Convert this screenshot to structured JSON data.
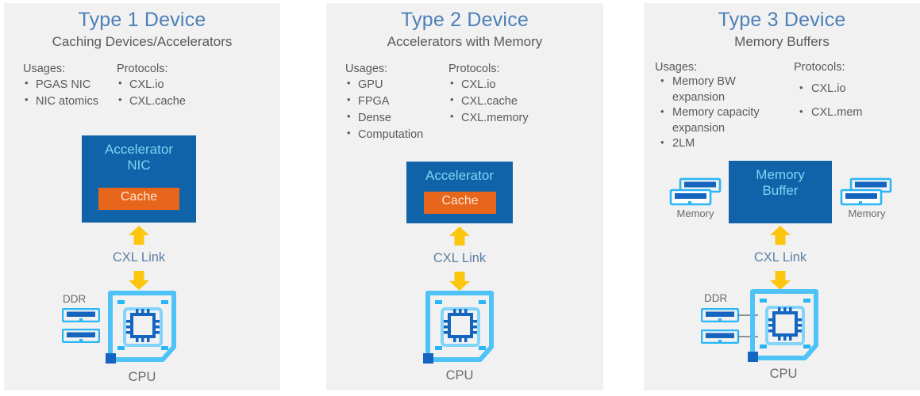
{
  "meta": {
    "colors": {
      "panel_bg": "#f1f1f1",
      "page_bg": "#ffffff",
      "title_blue": "#4d80b8",
      "device_blue": "#1063a8",
      "cache_orange": "#e8661b",
      "arrow_yellow": "#fcc60e",
      "cxl_link_text": "#5d7fa4",
      "body_gray": "#5a5a5a",
      "cpu_cyan": "#4fc3f7",
      "dimm_blue": "#1565c0"
    }
  },
  "panels": [
    {
      "title": "Type 1 Device",
      "subtitle": "Caching Devices/Accelerators",
      "usages_head": "Usages:",
      "usages": [
        "PGAS NIC",
        "NIC atomics"
      ],
      "protocols_head": "Protocols:",
      "protocols": [
        "CXL.io",
        "CXL.cache"
      ],
      "device_label": "Accelerator\nNIC",
      "device_label_line1": "Accelerator",
      "device_label_line2": "NIC",
      "cache_label": "Cache",
      "link_label": "CXL Link",
      "ddr_label": "DDR",
      "cpu_label": "CPU",
      "memory_label": ""
    },
    {
      "title": "Type 2 Device",
      "subtitle": "Accelerators with Memory",
      "usages_head": "Usages:",
      "usages": [
        "GPU",
        "FPGA",
        "Dense",
        "Computation"
      ],
      "protocols_head": "Protocols:",
      "protocols": [
        "CXL.io",
        "CXL.cache",
        "CXL.memory"
      ],
      "device_label_line1": "Accelerator",
      "device_label_line2": "",
      "cache_label": "Cache",
      "link_label": "CXL Link",
      "ddr_label": "",
      "cpu_label": "CPU",
      "memory_label": ""
    },
    {
      "title": "Type 3 Device",
      "subtitle": "Memory Buffers",
      "usages_head": "Usages:",
      "usages": [
        "Memory BW",
        "expansion",
        "Memory capacity",
        "expansion",
        "2LM"
      ],
      "protocols_head": "Protocols:",
      "protocols": [
        "CXL.io",
        "CXL.mem"
      ],
      "device_label_line1": "Memory",
      "device_label_line2": "Buffer",
      "cache_label": "",
      "link_label": "CXL Link",
      "ddr_label": "DDR",
      "cpu_label": "CPU",
      "memory_label_left": "Memory",
      "memory_label_right": "Memory"
    }
  ]
}
